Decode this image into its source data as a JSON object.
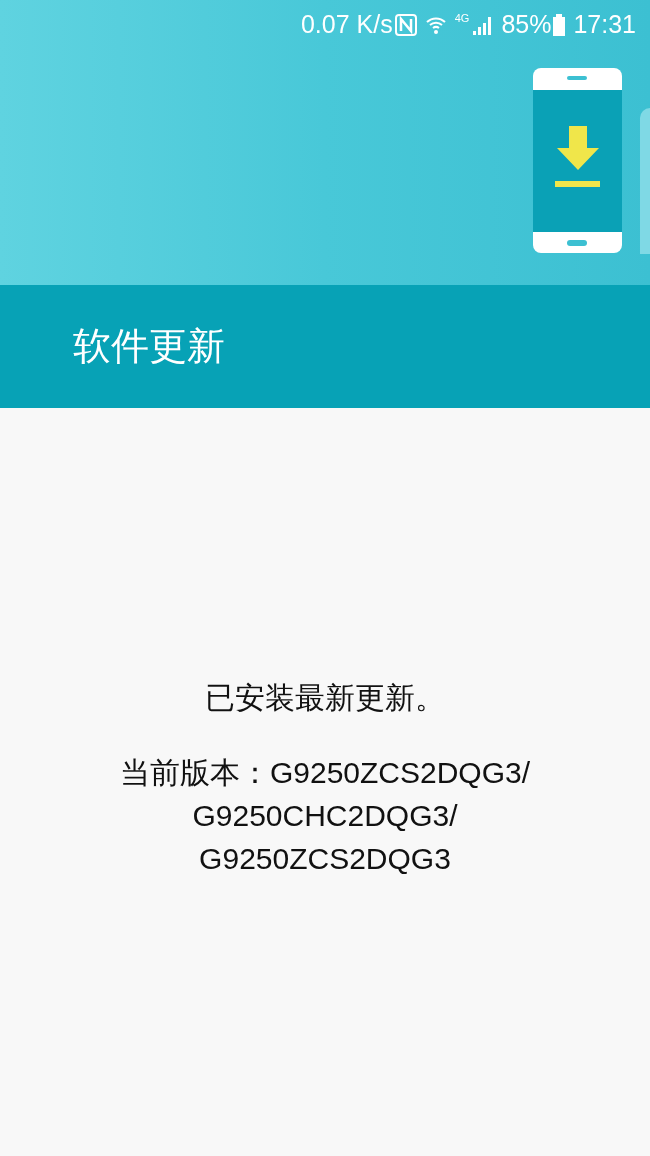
{
  "status_bar": {
    "speed": "0.07 K/s",
    "network": "4G",
    "battery": "85%",
    "time": "17:31"
  },
  "header": {
    "title": "软件更新"
  },
  "message": "已安装最新更新。",
  "version_lines": [
    "当前版本：G9250ZCS2DQG3/",
    "G9250CHC2DQG3/",
    "G9250ZCS2DQG3"
  ]
}
